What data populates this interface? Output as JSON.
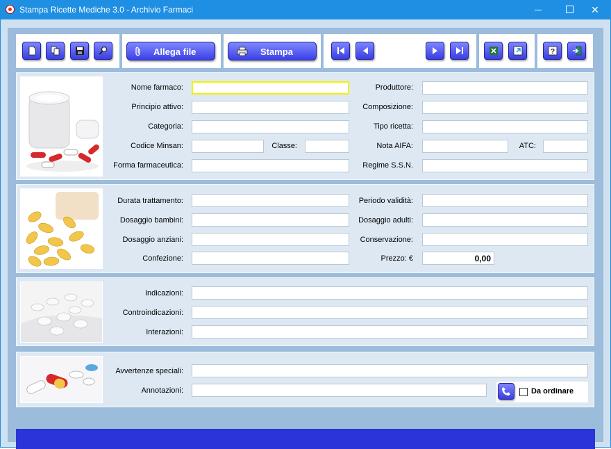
{
  "window": {
    "title": "Stampa Ricette Mediche 3.0 - Archivio Farmaci",
    "minimize_glyph": "",
    "maximize_glyph": "",
    "close_glyph": "✕"
  },
  "toolbar": {
    "attach_label": "Allega file",
    "print_label": "Stampa"
  },
  "section1": {
    "labels": {
      "nome_farmaco": "Nome farmaco:",
      "principio_attivo": "Principio attivo:",
      "categoria": "Categoria:",
      "codice_minsan": "Codice Minsan:",
      "classe": "Classe:",
      "forma_farmaceutica": "Forma farmaceutica:",
      "produttore": "Produttore:",
      "composizione": "Composizione:",
      "tipo_ricetta": "Tipo ricetta:",
      "nota_aifa": "Nota AIFA:",
      "atc": "ATC:",
      "regime_ssn": "Regime S.S.N."
    },
    "values": {
      "nome_farmaco": "",
      "principio_attivo": "",
      "categoria": "",
      "codice_minsan": "",
      "classe": "",
      "forma_farmaceutica": "",
      "produttore": "",
      "composizione": "",
      "tipo_ricetta": "",
      "nota_aifa": "",
      "atc": "",
      "regime_ssn": ""
    }
  },
  "section2": {
    "labels": {
      "durata_trattamento": "Durata trattamento:",
      "dosaggio_bambini": "Dosaggio bambini:",
      "dosaggio_anziani": "Dosaggio anziani:",
      "confezione": "Confezione:",
      "periodo_validita": "Periodo validità:",
      "dosaggio_adulti": "Dosaggio adulti:",
      "conservazione": "Conservazione:",
      "prezzo": "Prezzo: €"
    },
    "values": {
      "durata_trattamento": "",
      "dosaggio_bambini": "",
      "dosaggio_anziani": "",
      "confezione": "",
      "periodo_validita": "",
      "dosaggio_adulti": "",
      "conservazione": "",
      "prezzo": "0,00"
    }
  },
  "section3": {
    "labels": {
      "indicazioni": "Indicazioni:",
      "controindicazioni": "Controindicazioni:",
      "interazioni": "Interazioni:"
    },
    "values": {
      "indicazioni": "",
      "controindicazioni": "",
      "interazioni": ""
    }
  },
  "section4": {
    "labels": {
      "avvertenze_speciali": "Avvertenze speciali:",
      "annotazioni": "Annotazioni:",
      "da_ordinare": "Da ordinare"
    },
    "values": {
      "avvertenze_speciali": "",
      "annotazioni": "",
      "da_ordinare": false
    }
  },
  "icons": [
    "new-record-icon",
    "copy-record-icon",
    "save-icon",
    "search-icon",
    "paperclip-icon",
    "printer-icon",
    "first-record-icon",
    "previous-record-icon",
    "next-record-icon",
    "last-record-icon",
    "excel-export-icon",
    "open-external-icon",
    "help-icon",
    "exit-icon",
    "phone-icon"
  ],
  "colors": {
    "titlebar": "#1f8fe3",
    "button": "#4a50f0",
    "statusbar": "#2a34d8",
    "active_field_border": "#f2f200",
    "panel": "#dde8f3"
  }
}
